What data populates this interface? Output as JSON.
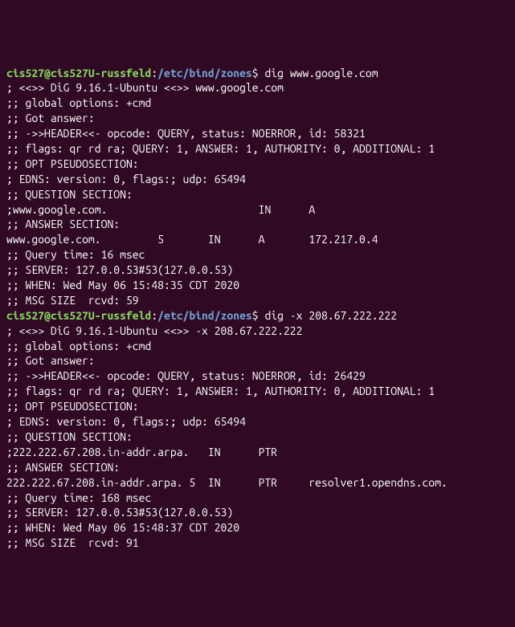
{
  "prompt": {
    "user_host": "cis527@cis527U-russfeld",
    "colon": ":",
    "path": "/etc/bind/zones",
    "dollar": "$"
  },
  "cmd1": {
    "command": " dig www.google.com",
    "output": [
      "",
      "; <<>> DiG 9.16.1-Ubuntu <<>> www.google.com",
      ";; global options: +cmd",
      ";; Got answer:",
      ";; ->>HEADER<<- opcode: QUERY, status: NOERROR, id: 58321",
      ";; flags: qr rd ra; QUERY: 1, ANSWER: 1, AUTHORITY: 0, ADDITIONAL: 1",
      "",
      ";; OPT PSEUDOSECTION:",
      "; EDNS: version: 0, flags:; udp: 65494",
      ";; QUESTION SECTION:",
      ";www.google.com.                        IN      A",
      "",
      ";; ANSWER SECTION:",
      "www.google.com.         5       IN      A       172.217.0.4",
      "",
      ";; Query time: 16 msec",
      ";; SERVER: 127.0.0.53#53(127.0.0.53)",
      ";; WHEN: Wed May 06 15:48:35 CDT 2020",
      ";; MSG SIZE  rcvd: 59",
      ""
    ]
  },
  "cmd2": {
    "command": " dig -x 208.67.222.222",
    "output": [
      "",
      "; <<>> DiG 9.16.1-Ubuntu <<>> -x 208.67.222.222",
      ";; global options: +cmd",
      ";; Got answer:",
      ";; ->>HEADER<<- opcode: QUERY, status: NOERROR, id: 26429",
      ";; flags: qr rd ra; QUERY: 1, ANSWER: 1, AUTHORITY: 0, ADDITIONAL: 1",
      "",
      ";; OPT PSEUDOSECTION:",
      "; EDNS: version: 0, flags:; udp: 65494",
      ";; QUESTION SECTION:",
      ";222.222.67.208.in-addr.arpa.   IN      PTR",
      "",
      ";; ANSWER SECTION:",
      "222.222.67.208.in-addr.arpa. 5  IN      PTR     resolver1.opendns.com.",
      "",
      ";; Query time: 168 msec",
      ";; SERVER: 127.0.0.53#53(127.0.0.53)",
      ";; WHEN: Wed May 06 15:48:37 CDT 2020",
      ";; MSG SIZE  rcvd: 91"
    ]
  }
}
